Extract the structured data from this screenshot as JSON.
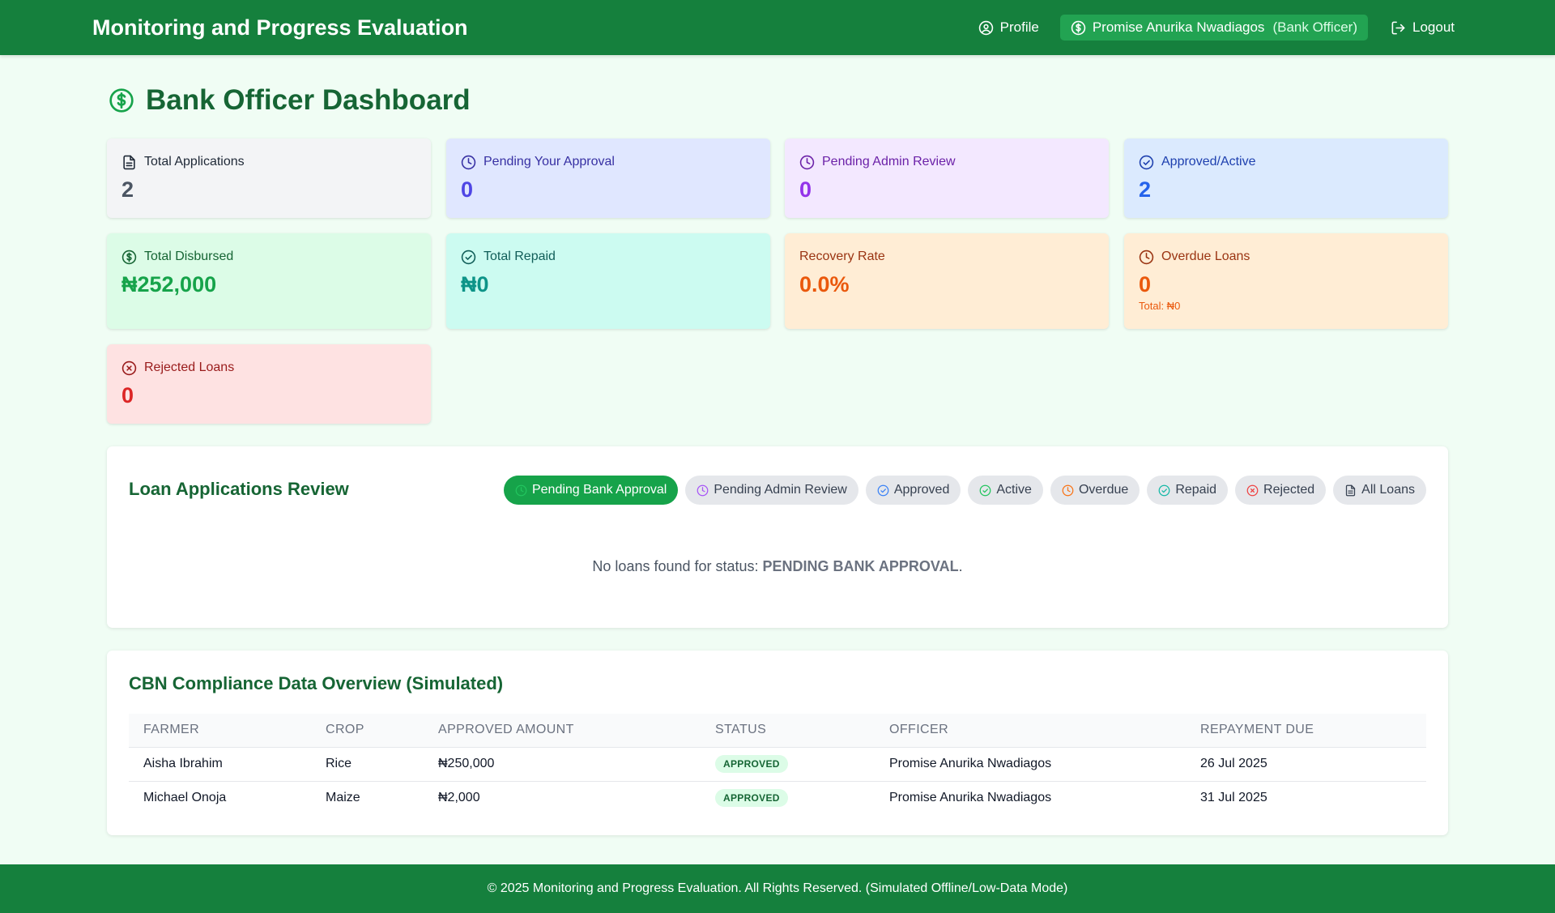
{
  "header": {
    "app_title": "Monitoring and Progress Evaluation",
    "profile_label": "Profile",
    "user_name": "Promise Anurika Nwadiagos",
    "user_role": "(Bank Officer)",
    "logout_label": "Logout"
  },
  "page": {
    "title": "Bank Officer Dashboard"
  },
  "stats": {
    "total_applications": {
      "label": "Total Applications",
      "value": "2",
      "icon": "document-icon"
    },
    "pending_your_approval": {
      "label": "Pending Your Approval",
      "value": "0",
      "icon": "clock-icon"
    },
    "pending_admin_review": {
      "label": "Pending Admin Review",
      "value": "0",
      "icon": "clock-icon"
    },
    "approved_active": {
      "label": "Approved/Active",
      "value": "2",
      "icon": "check-circle-icon"
    },
    "total_disbursed": {
      "label": "Total Disbursed",
      "value": "₦252,000",
      "icon": "dollar-circle-icon"
    },
    "total_repaid": {
      "label": "Total Repaid",
      "value": "₦0",
      "icon": "check-circle-icon"
    },
    "recovery_rate": {
      "label": "Recovery Rate",
      "value": "0.0%"
    },
    "overdue_loans": {
      "label": "Overdue Loans",
      "value": "0",
      "sub": "Total: ₦0",
      "icon": "clock-icon"
    },
    "rejected_loans": {
      "label": "Rejected Loans",
      "value": "0",
      "icon": "x-circle-icon"
    }
  },
  "review": {
    "title": "Loan Applications Review",
    "filters": [
      {
        "label": "Pending Bank Approval",
        "active": true,
        "color": "#ffffff"
      },
      {
        "label": "Pending Admin Review",
        "active": false,
        "color": "#a855f7"
      },
      {
        "label": "Approved",
        "active": false,
        "color": "#3b82f6"
      },
      {
        "label": "Active",
        "active": false,
        "color": "#22c55e"
      },
      {
        "label": "Overdue",
        "active": false,
        "color": "#f97316"
      },
      {
        "label": "Repaid",
        "active": false,
        "color": "#14b8a6"
      },
      {
        "label": "Rejected",
        "active": false,
        "color": "#ef4444"
      },
      {
        "label": "All Loans",
        "active": false,
        "color": "#374151"
      }
    ],
    "empty_prefix": "No loans found for status: ",
    "empty_status": "PENDING BANK APPROVAL",
    "empty_suffix": "."
  },
  "compliance": {
    "title": "CBN Compliance Data Overview (Simulated)",
    "columns": [
      "FARMER",
      "CROP",
      "APPROVED AMOUNT",
      "STATUS",
      "OFFICER",
      "REPAYMENT DUE"
    ],
    "rows": [
      [
        "Aisha Ibrahim",
        "Rice",
        "₦250,000",
        "APPROVED",
        "Promise Anurika Nwadiagos",
        "26 Jul 2025"
      ],
      [
        "Michael Onoja",
        "Maize",
        "₦2,000",
        "APPROVED",
        "Promise Anurika Nwadiagos",
        "31 Jul 2025"
      ]
    ]
  },
  "footer": {
    "text": "© 2025 Monitoring and Progress Evaluation. All Rights Reserved. (Simulated Offline/Low-Data Mode)"
  },
  "colors": {
    "brand_green": "#15803d",
    "page_bg": "#f0fdf4"
  }
}
